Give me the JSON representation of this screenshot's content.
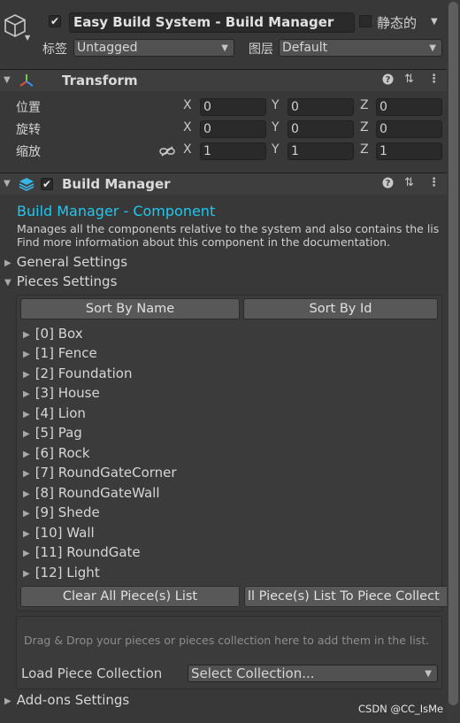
{
  "object": {
    "name": "Easy Build System - Build Manager",
    "static_label": "静态的",
    "tag_label": "标签",
    "tag_value": "Untagged",
    "layer_label": "图层",
    "layer_value": "Default"
  },
  "transform": {
    "title": "Transform",
    "position_label": "位置",
    "rotation_label": "旋转",
    "scale_label": "缩放",
    "axes": [
      "X",
      "Y",
      "Z"
    ],
    "position": [
      "0",
      "0",
      "0"
    ],
    "rotation": [
      "0",
      "0",
      "0"
    ],
    "scale": [
      "1",
      "1",
      "1"
    ]
  },
  "build_manager": {
    "title": "Build Manager",
    "component_title": "Build Manager - Component",
    "description_1": "Manages all the components relative to the system and also contains the lis",
    "description_2": "Find more information about this component in the documentation.",
    "general_settings": "General Settings",
    "pieces_settings": "Pieces Settings",
    "sort_by_name": "Sort By Name",
    "sort_by_id": "Sort By Id",
    "pieces": [
      "[0] Box",
      "[1] Fence",
      "[2] Foundation",
      "[3] House",
      "[4] Lion",
      "[5] Pag",
      "[6] Rock",
      "[7] RoundGateCorner",
      "[8] RoundGateWall",
      "[9] Shede",
      "[10] Wall",
      "[11] RoundGate",
      "[12] Light"
    ],
    "clear_button": "Clear All Piece(s) List",
    "save_button": "ll Piece(s) List To Piece Collect",
    "drop_hint": "Drag & Drop your pieces or pieces collection here to add them in the list.",
    "load_label": "Load Piece Collection",
    "collection_select": "Select Collection...",
    "addons_settings": "Add-ons Settings"
  },
  "watermark": "CSDN @CC_IsMe",
  "colors": {
    "accent": "#1ec8f0",
    "background": "#383838",
    "field": "#2a2a2a",
    "button": "#585858"
  },
  "icons": {
    "object": "cube-icon",
    "transform": "transform-axes-icon",
    "build_manager": "layers-icon",
    "help": "help-icon",
    "presets": "presets-icon",
    "menu": "kebab-menu-icon",
    "constrain": "link-icon"
  }
}
